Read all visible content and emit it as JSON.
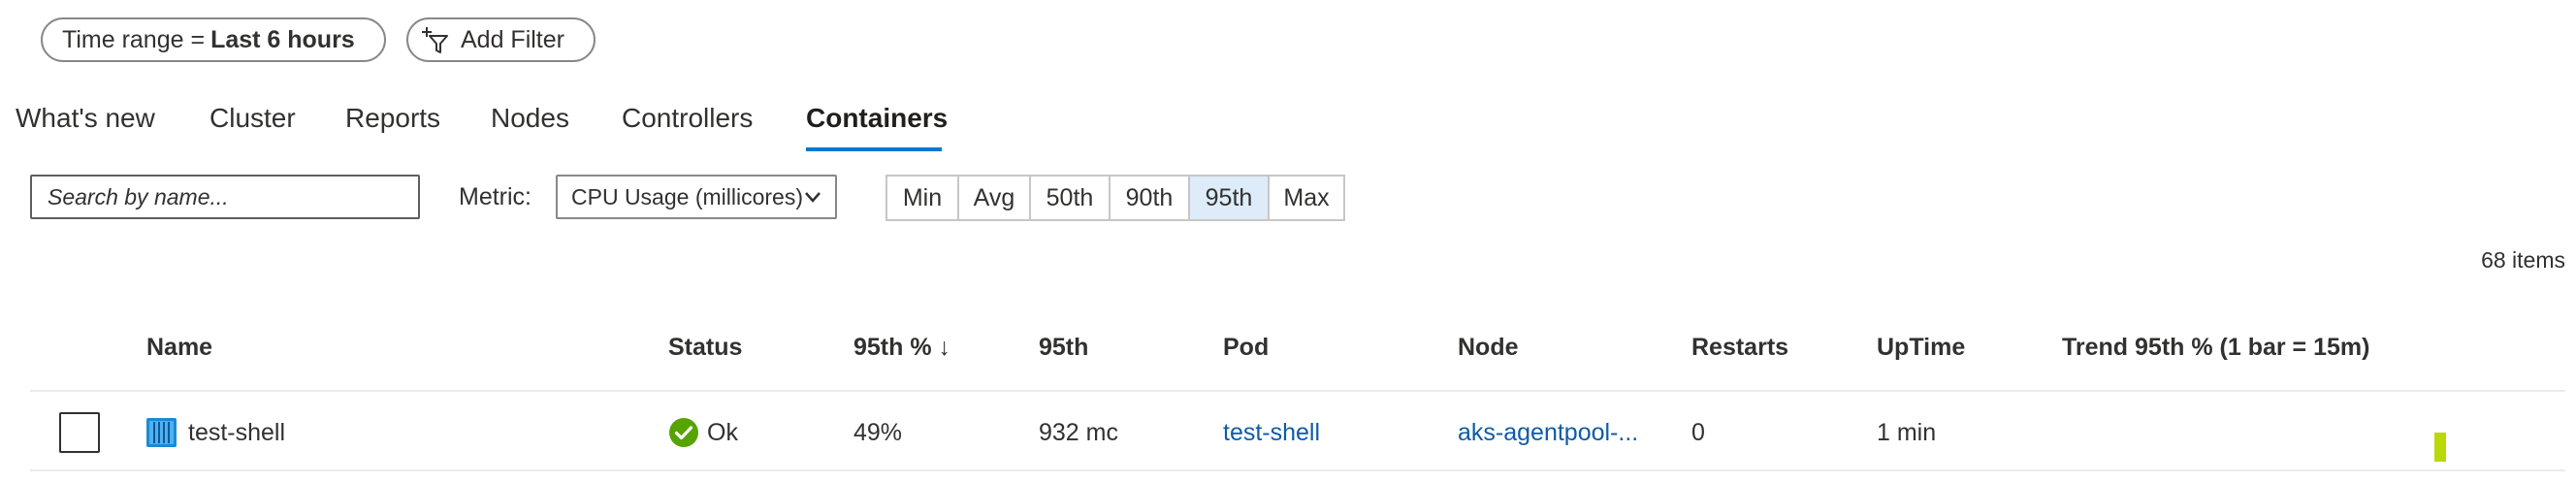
{
  "filters": {
    "time_label": "Time range =",
    "time_value": "Last 6 hours",
    "add_filter": "Add Filter"
  },
  "tabs": [
    {
      "label": "What's new"
    },
    {
      "label": "Cluster"
    },
    {
      "label": "Reports"
    },
    {
      "label": "Nodes"
    },
    {
      "label": "Controllers"
    },
    {
      "label": "Containers",
      "active": true
    }
  ],
  "toolbar": {
    "search_placeholder": "Search by name...",
    "metric_label": "Metric:",
    "metric_value": "CPU Usage (millicores)",
    "percentiles": [
      "Min",
      "Avg",
      "50th",
      "90th",
      "95th",
      "Max"
    ],
    "selected_percentile": "95th"
  },
  "items_count": "68 items",
  "table": {
    "headers": {
      "name": "Name",
      "status": "Status",
      "pct": "95th % ↓",
      "value": "95th",
      "pod": "Pod",
      "node": "Node",
      "restarts": "Restarts",
      "uptime": "UpTime",
      "trend": "Trend 95th % (1 bar = 15m)"
    },
    "rows": [
      {
        "name": "test-shell",
        "status": "Ok",
        "pct": "49%",
        "value": "932 mc",
        "pod": "test-shell",
        "node": "aks-agentpool-...",
        "restarts": "0",
        "uptime": "1 min",
        "trend_value_pct": 49
      }
    ]
  },
  "colors": {
    "accent": "#0078d4",
    "link": "#0f5ba7",
    "status_ok": "#57a300",
    "trend_bar": "#bad80a",
    "selected_segment": "#deecf9"
  }
}
